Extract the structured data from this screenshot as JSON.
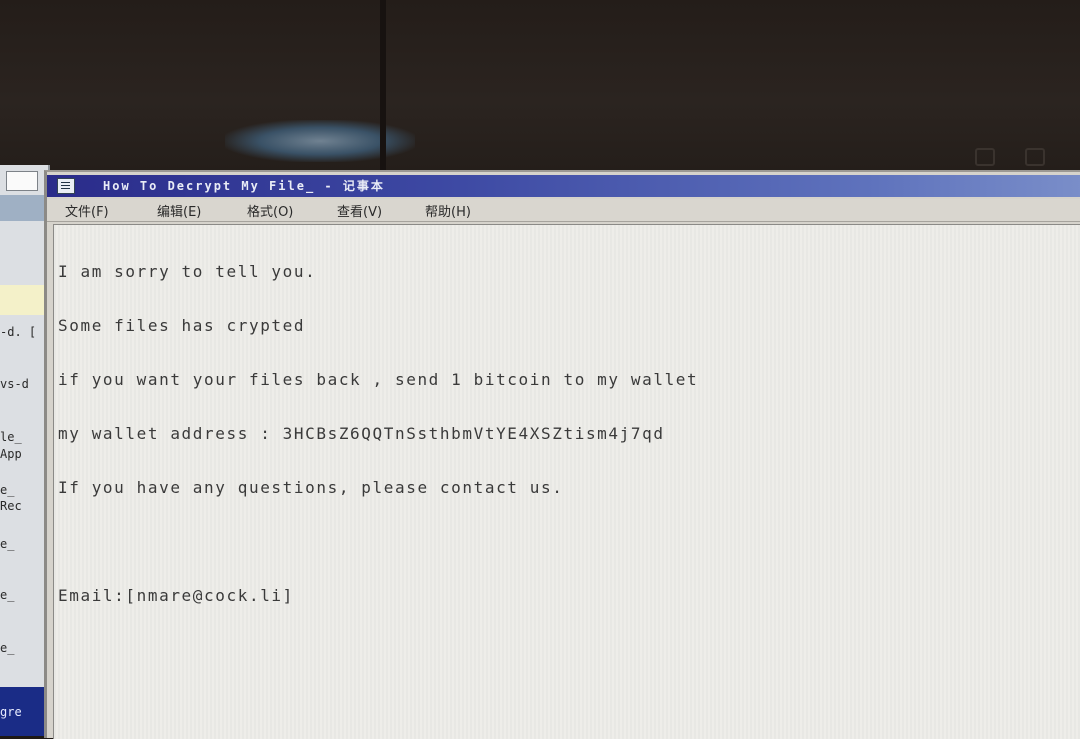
{
  "background_window": {
    "fragments": [
      "-d. [",
      "vs-d",
      "le_",
      "App",
      "e_",
      "Rec",
      "e_",
      "e_",
      "e_",
      "gre"
    ]
  },
  "notepad": {
    "title": "How To Decrypt My File_ - 记事本",
    "menu": [
      {
        "label": "文件(F)"
      },
      {
        "label": "编辑(E)"
      },
      {
        "label": "格式(O)"
      },
      {
        "label": "查看(V)"
      },
      {
        "label": "帮助(H)"
      }
    ],
    "content_lines": [
      "I am sorry to tell you.",
      "Some files has crypted",
      "if you want your files back , send 1 bitcoin to my wallet",
      "my wallet address : 3HCBsZ6QQTnSsthbmVtYE4XSZtism4j7qd",
      "If you have any questions, please contact us.",
      "",
      "Email:[nmare@cock.li]"
    ]
  }
}
